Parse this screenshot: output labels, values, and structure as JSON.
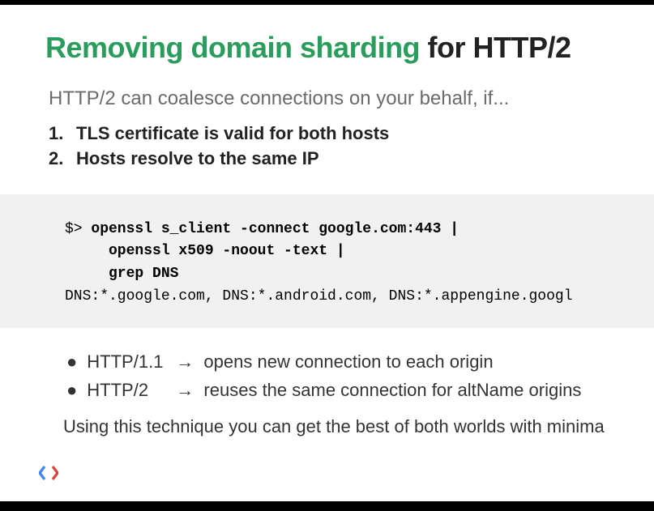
{
  "title": {
    "green": "Removing domain sharding",
    "black": " for HTTP/2"
  },
  "subtitle": "HTTP/2 can coalesce connections on your behalf, if...",
  "conditions": [
    {
      "num": "1.",
      "text": "TLS certificate is valid for both hosts"
    },
    {
      "num": "2.",
      "text": "Hosts resolve to the same IP"
    }
  ],
  "code": {
    "prompt": "$> ",
    "cmd1": "openssl s_client -connect google.com:443 |",
    "cmd2": "     openssl x509 -noout -text |",
    "cmd3": "     grep DNS",
    "output": "DNS:*.google.com, DNS:*.android.com, DNS:*.appengine.googl"
  },
  "bullets": [
    {
      "proto": "HTTP/1.1",
      "arrow": "→",
      "text": "opens new connection to each origin"
    },
    {
      "proto": "HTTP/2",
      "arrow": "→",
      "text": "reuses the same connection for altName origins"
    }
  ],
  "footnote": "Using this technique you can get the best of both worlds with minima"
}
